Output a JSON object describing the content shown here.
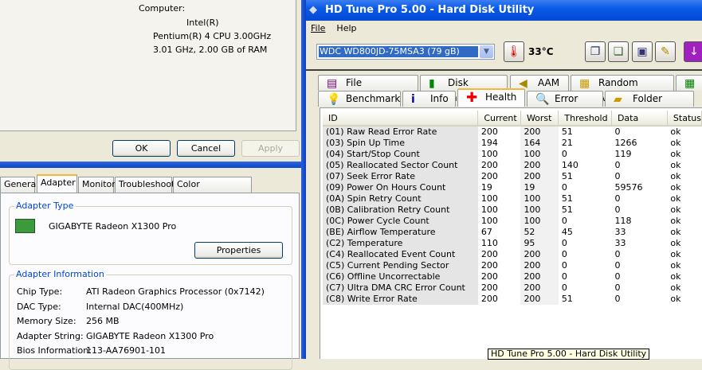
{
  "system": {
    "computer_label": "Computer:",
    "cpu1": "Intel(R)",
    "cpu2": "Pentium(R) 4 CPU 3.00GHz",
    "cpu3": "3.01 GHz, 2.00 GB of RAM",
    "ok": "OK",
    "cancel": "Cancel",
    "apply": "Apply"
  },
  "display": {
    "tabs": [
      "General",
      "Adapter",
      "Monitor",
      "Troubleshoot",
      "Color Management"
    ],
    "adapter_type_label": "Adapter Type",
    "adapter_name": "GIGABYTE Radeon X1300 Pro",
    "properties": "Properties",
    "adapter_info_label": "Adapter Information",
    "info": [
      {
        "k": "Chip Type:",
        "v": "ATI Radeon Graphics Processor (0x7142)"
      },
      {
        "k": "DAC Type:",
        "v": "Internal DAC(400MHz)"
      },
      {
        "k": "Memory Size:",
        "v": "256 MB"
      },
      {
        "k": "Adapter String:",
        "v": "GIGABYTE Radeon X1300 Pro"
      },
      {
        "k": "Bios Information:",
        "v": "113-AA76901-101"
      }
    ]
  },
  "hdtune": {
    "title": "HD Tune Pro 5.00 - Hard Disk Utility",
    "menu": [
      "File",
      "Help"
    ],
    "drive": "WDC WD800JD-75MSA3 (79 gB)",
    "temperature": "33°C",
    "tabs_row1": [
      "File Benchmark",
      "Disk monitor",
      "AAM",
      "Random Access"
    ],
    "tabs_row2": [
      "Benchmark",
      "Info",
      "Health",
      "Error Scan",
      "Folder Usage"
    ],
    "columns": [
      "ID",
      "Current",
      "Worst",
      "Threshold",
      "Data",
      "Status"
    ],
    "rows": [
      [
        "(01) Raw Read Error Rate",
        "200",
        "200",
        "51",
        "0",
        "ok"
      ],
      [
        "(03) Spin Up Time",
        "194",
        "164",
        "21",
        "1266",
        "ok"
      ],
      [
        "(04) Start/Stop Count",
        "100",
        "100",
        "0",
        "119",
        "ok"
      ],
      [
        "(05) Reallocated Sector Count",
        "200",
        "200",
        "140",
        "0",
        "ok"
      ],
      [
        "(07) Seek Error Rate",
        "200",
        "200",
        "51",
        "0",
        "ok"
      ],
      [
        "(09) Power On Hours Count",
        "19",
        "19",
        "0",
        "59576",
        "ok"
      ],
      [
        "(0A) Spin Retry Count",
        "100",
        "100",
        "51",
        "0",
        "ok"
      ],
      [
        "(0B) Calibration Retry Count",
        "100",
        "100",
        "51",
        "0",
        "ok"
      ],
      [
        "(0C) Power Cycle Count",
        "100",
        "100",
        "0",
        "118",
        "ok"
      ],
      [
        "(BE) Airflow Temperature",
        "67",
        "52",
        "45",
        "33",
        "ok"
      ],
      [
        "(C2) Temperature",
        "110",
        "95",
        "0",
        "33",
        "ok"
      ],
      [
        "(C4) Reallocated Event Count",
        "200",
        "200",
        "0",
        "0",
        "ok"
      ],
      [
        "(C5) Current Pending Sector",
        "200",
        "200",
        "0",
        "0",
        "ok"
      ],
      [
        "(C6) Offline Uncorrectable",
        "200",
        "200",
        "0",
        "0",
        "ok"
      ],
      [
        "(C7) Ultra DMA CRC Error Count",
        "200",
        "200",
        "0",
        "0",
        "ok"
      ],
      [
        "(C8) Write Error Rate",
        "200",
        "200",
        "51",
        "0",
        "ok"
      ]
    ],
    "tooltip": "HD Tune Pro 5.00 - Hard Disk Utility"
  }
}
